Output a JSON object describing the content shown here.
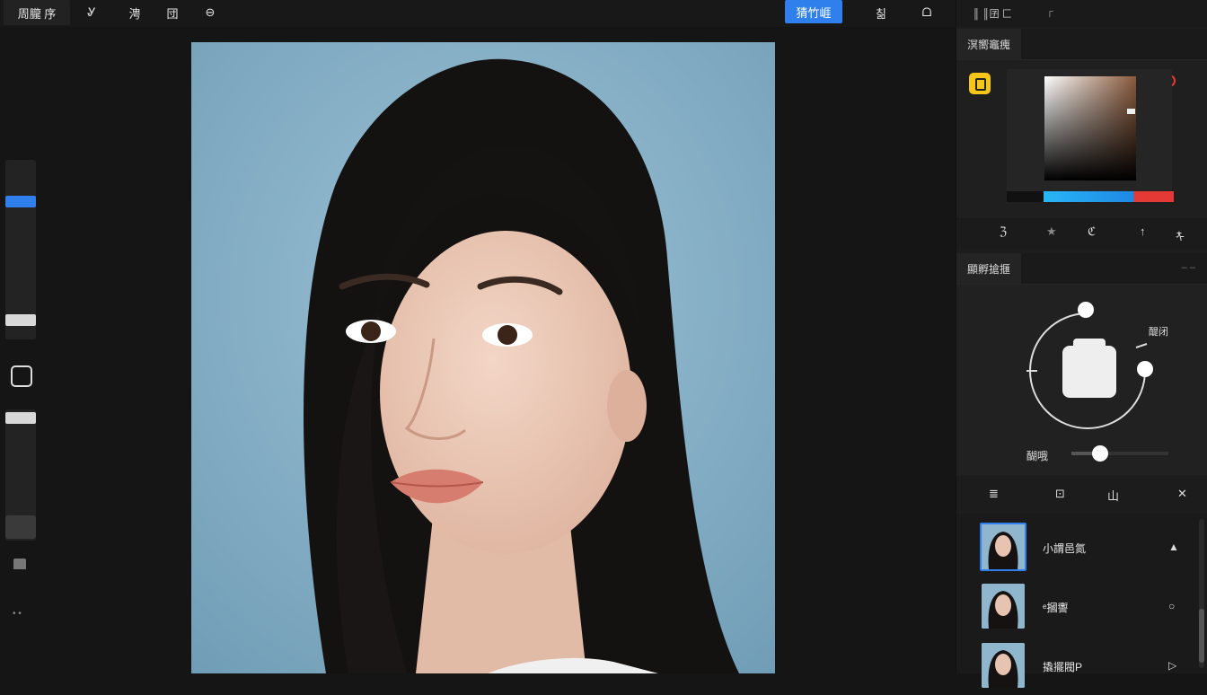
{
  "toolbar": {
    "menu_label": "周朧 序",
    "tool1": "Ꮍ",
    "tool2": "涄",
    "tool3": "団",
    "tool4": "⊖",
    "primary_label": "猜竹崕",
    "right1": "칢",
    "right2": "ᗝ",
    "status_left": "║ ║囝 匚",
    "status_right": "┌"
  },
  "colors": {
    "accent": "#2f80ed",
    "bg": "#151515",
    "panel": "#1d1d1d",
    "swatch_yellow": "#f5c518",
    "hue_red": "#e53935",
    "hue_blue": "#29b6f6"
  },
  "color_panel": {
    "title": "溟嚮竈瘣"
  },
  "color_tools": [
    "ℨ",
    "★",
    "ℭ",
    "↑",
    "ᡮ"
  ],
  "transform_panel": {
    "title": "顯孵搶擓",
    "dial_label": "醍闭",
    "slider_label": "醐哦",
    "slider_value": 0.3
  },
  "layer_tools": [
    "≣",
    "⊡",
    "山",
    "✕"
  ],
  "layers": [
    {
      "name": "小謂邑氮",
      "vis": "▲"
    },
    {
      "name": "ᵉ摑讏",
      "vis": "○"
    },
    {
      "name": "撬擺閥P",
      "vis": "▷"
    }
  ]
}
